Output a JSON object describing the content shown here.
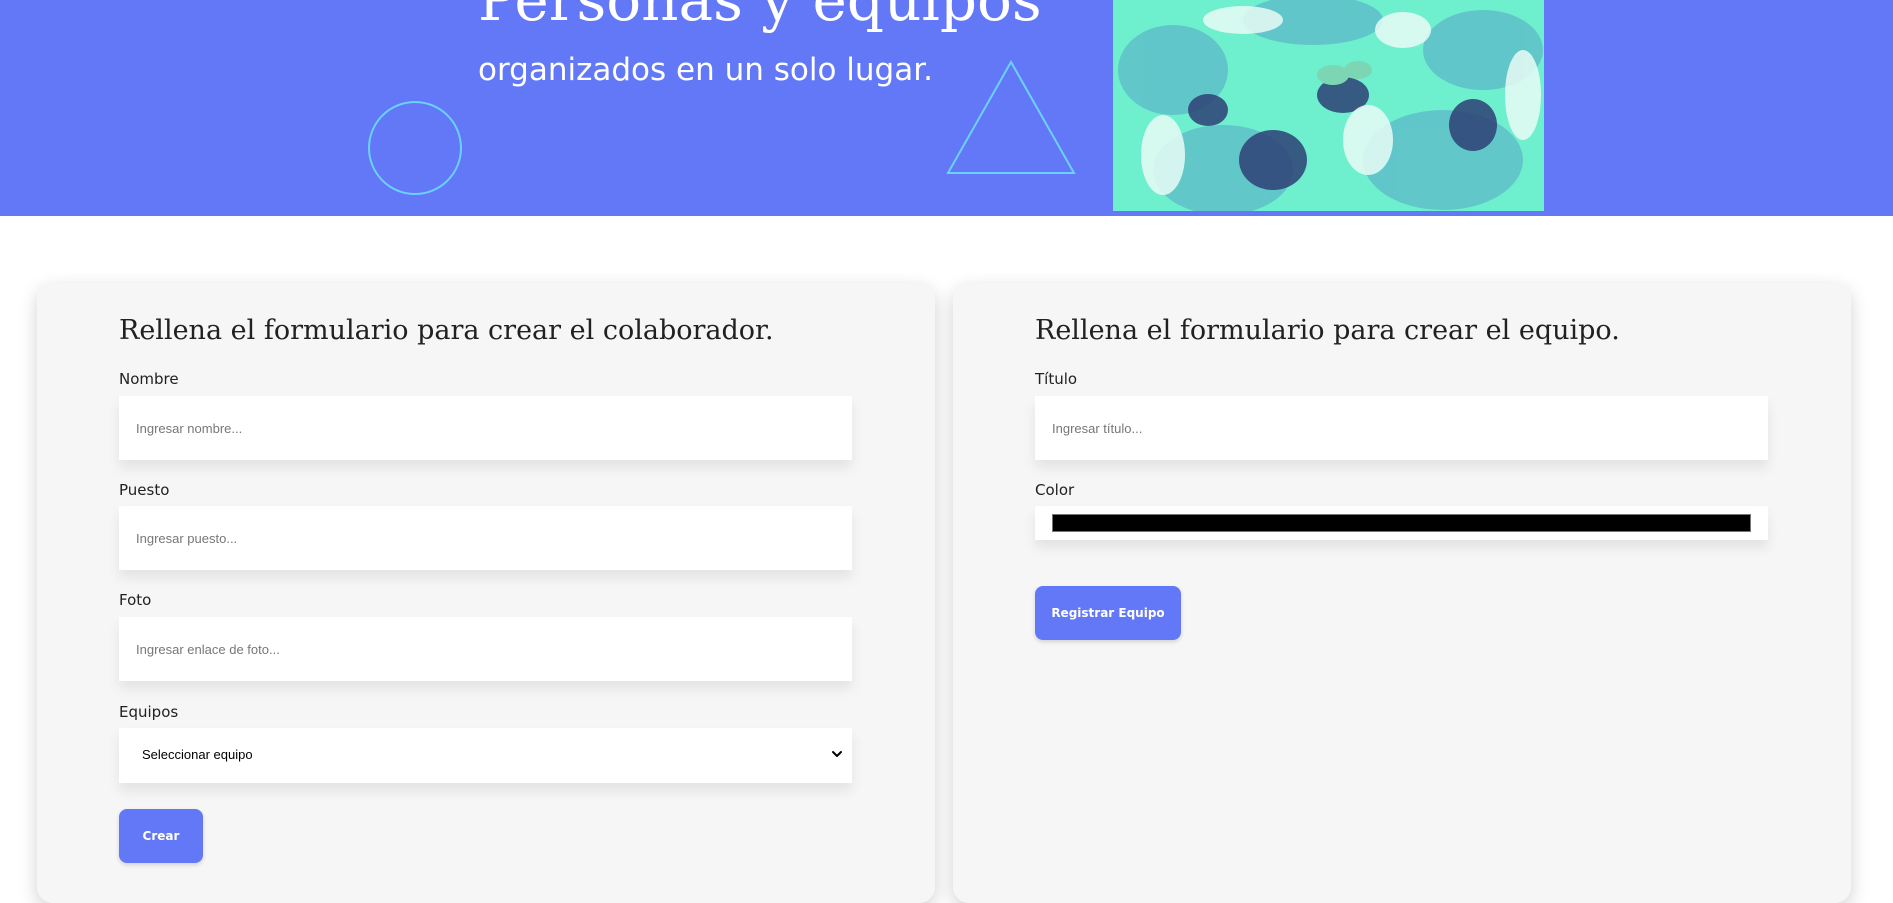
{
  "hero": {
    "title": "Personas y equipos",
    "subtitle": "organizados en un solo lugar.",
    "colors": {
      "background": "#6278f7",
      "shape_outline": "#6bd1ff",
      "image_tint": "#6ef0cf"
    }
  },
  "collaborator_form": {
    "title": "Rellena el formulario para crear el colaborador.",
    "fields": {
      "name": {
        "label": "Nombre",
        "placeholder": "Ingresar nombre..."
      },
      "position": {
        "label": "Puesto",
        "placeholder": "Ingresar puesto..."
      },
      "photo": {
        "label": "Foto",
        "placeholder": "Ingresar enlace de foto..."
      },
      "team": {
        "label": "Equipos",
        "selected": "Seleccionar equipo"
      }
    },
    "submit_label": "Crear"
  },
  "team_form": {
    "title": "Rellena el formulario para crear el equipo.",
    "fields": {
      "title": {
        "label": "Título",
        "placeholder": "Ingresar título..."
      },
      "color": {
        "label": "Color",
        "value": "#000000"
      }
    },
    "submit_label": "Registrar Equipo"
  },
  "icons": {
    "select_chevron": "chevron-down-icon"
  }
}
